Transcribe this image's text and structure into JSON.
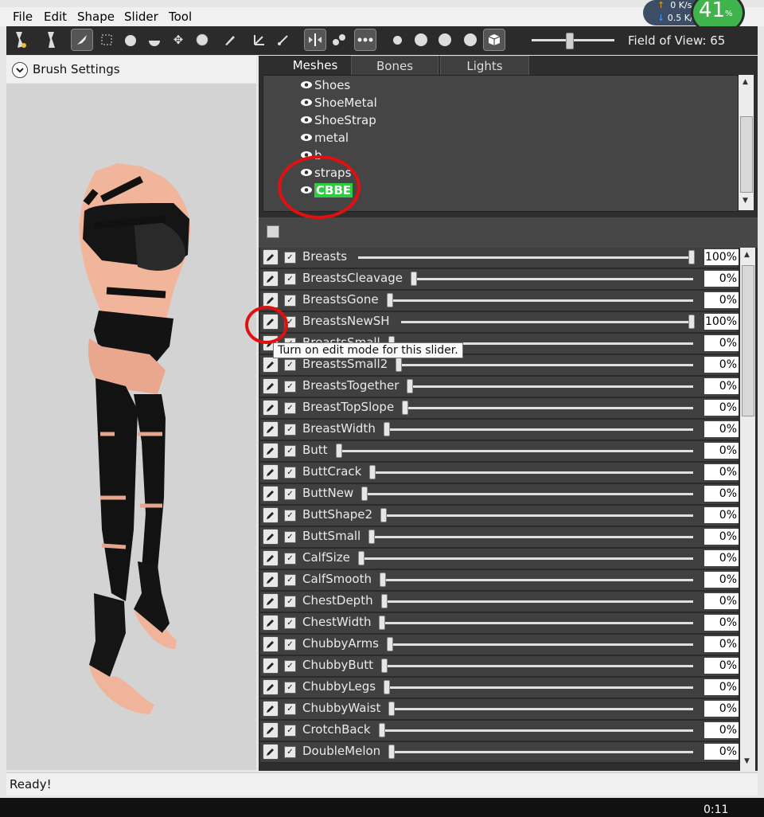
{
  "menubar": [
    "File",
    "Edit",
    "Shape",
    "Slider",
    "Tool"
  ],
  "toolbar": {
    "field_of_view_label": "Field of View: 65",
    "field_of_view_value": 65
  },
  "netmeter": {
    "up": "0 K/s",
    "down": "0.5 K/s",
    "percent": "41",
    "percent_sign": "%"
  },
  "left_panel": {
    "brush_settings_label": "Brush Settings"
  },
  "tabs": [
    "Meshes",
    "Bones",
    "Lights"
  ],
  "meshes": [
    "Shoes",
    "ShoeMetal",
    "ShoeStrap",
    "metal",
    "b",
    "straps",
    "CBBE"
  ],
  "selected_mesh": "CBBE",
  "sliders": [
    {
      "name": "Breasts",
      "value": "100%",
      "pos": 1.0
    },
    {
      "name": "BreastsCleavage",
      "value": "0%",
      "pos": 0
    },
    {
      "name": "BreastsGone",
      "value": "0%",
      "pos": 0
    },
    {
      "name": "BreastsNewSH",
      "value": "100%",
      "pos": 1.0
    },
    {
      "name": "BreastsSmall",
      "value": "0%",
      "pos": 0
    },
    {
      "name": "BreastsSmall2",
      "value": "0%",
      "pos": 0
    },
    {
      "name": "BreastsTogether",
      "value": "0%",
      "pos": 0
    },
    {
      "name": "BreastTopSlope",
      "value": "0%",
      "pos": 0
    },
    {
      "name": "BreastWidth",
      "value": "0%",
      "pos": 0
    },
    {
      "name": "Butt",
      "value": "0%",
      "pos": 0
    },
    {
      "name": "ButtCrack",
      "value": "0%",
      "pos": 0
    },
    {
      "name": "ButtNew",
      "value": "0%",
      "pos": 0
    },
    {
      "name": "ButtShape2",
      "value": "0%",
      "pos": 0
    },
    {
      "name": "ButtSmall",
      "value": "0%",
      "pos": 0
    },
    {
      "name": "CalfSize",
      "value": "0%",
      "pos": 0
    },
    {
      "name": "CalfSmooth",
      "value": "0%",
      "pos": 0
    },
    {
      "name": "ChestDepth",
      "value": "0%",
      "pos": 0
    },
    {
      "name": "ChestWidth",
      "value": "0%",
      "pos": 0
    },
    {
      "name": "ChubbyArms",
      "value": "0%",
      "pos": 0
    },
    {
      "name": "ChubbyButt",
      "value": "0%",
      "pos": 0
    },
    {
      "name": "ChubbyLegs",
      "value": "0%",
      "pos": 0
    },
    {
      "name": "ChubbyWaist",
      "value": "0%",
      "pos": 0
    },
    {
      "name": "CrotchBack",
      "value": "0%",
      "pos": 0
    },
    {
      "name": "DoubleMelon",
      "value": "0%",
      "pos": 0
    }
  ],
  "tooltip": "Turn on edit mode for this slider.",
  "status": "Ready!",
  "taskbar": {
    "clock": "0:11"
  },
  "colors": {
    "panel_dark": "#2e2e2e",
    "row": "#404040",
    "selected_mesh_bg": "#2ecc40",
    "annotation": "#e01010"
  }
}
